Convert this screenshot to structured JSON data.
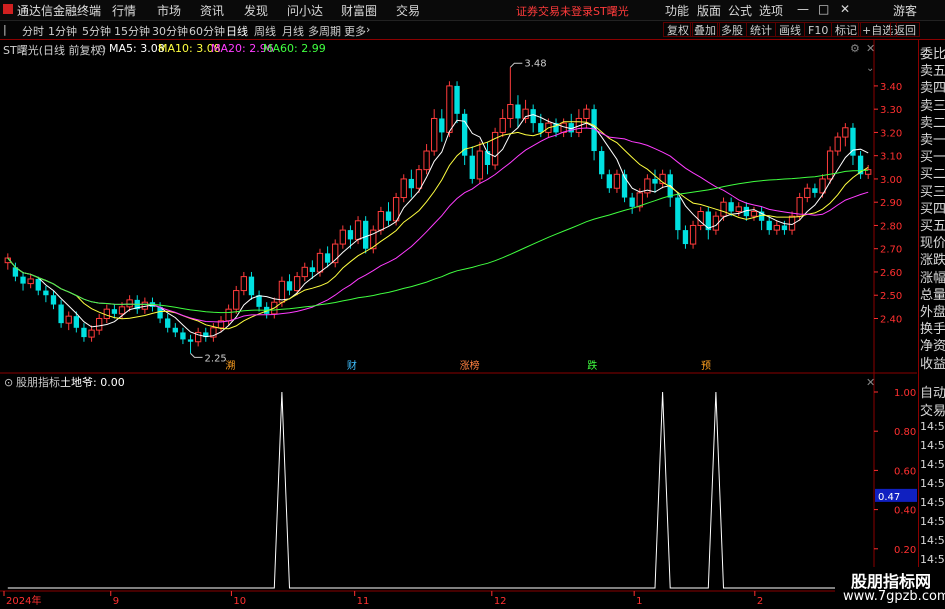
{
  "menubar": {
    "app_title": "通达信金融终端",
    "menus": [
      "行情",
      "市场",
      "资讯",
      "发现",
      "问小达",
      "财富圈",
      "交易"
    ],
    "login_alert": "证券交易未登录",
    "stock_title": "ST曙光",
    "right_menus": [
      "功能",
      "版面",
      "公式",
      "选项"
    ],
    "guest": "游客"
  },
  "toolbar": {
    "periods": [
      "分时",
      "1分钟",
      "5分钟",
      "15分钟",
      "30分钟",
      "60分钟",
      "日线",
      "周线",
      "月线",
      "多周期",
      "更多"
    ],
    "active_period": "日线",
    "right_buttons": [
      "复权",
      "叠加",
      "多股",
      "统计",
      "画线",
      "F10",
      "标记",
      "+自选",
      "返回"
    ]
  },
  "info": {
    "stock_label": "ST曙光(日线 前复权)",
    "ma5": "MA5: 3.08",
    "ma10": "MA10: 3.08",
    "ma20": "MA20: 2.96",
    "ma60": "MA60: 2.99"
  },
  "indicator": {
    "name": "股朋指标",
    "value_label": "土地爷: 0.00"
  },
  "price_axis": [
    "3.40",
    "3.30",
    "3.20",
    "3.10",
    "3.00",
    "2.90",
    "2.80",
    "2.70",
    "2.60",
    "2.50",
    "2.40"
  ],
  "indicator_axis": [
    "1.00",
    "0.80",
    "0.60",
    "0.47",
    "0.40",
    "0.20"
  ],
  "current_indicator_value": "0.47",
  "high_label": "3.48",
  "low_label": "2.25",
  "event_markers": [
    "溯",
    "财",
    "涨榜",
    "跌",
    "预"
  ],
  "date_axis": [
    "2024年",
    "9",
    "10",
    "11",
    "12",
    "1",
    "2"
  ],
  "right_panel": {
    "labels": [
      "委比",
      "卖五",
      "卖四",
      "卖三",
      "卖二",
      "卖一",
      "买一",
      "买二",
      "买三",
      "买四",
      "买五",
      "现价",
      "涨跌",
      "涨幅",
      "总量",
      "外盘",
      "换手",
      "净资",
      "收益"
    ],
    "labels2": [
      "自动",
      "交易"
    ],
    "times": [
      "14:53",
      "14:54",
      "14:54",
      "14:54",
      "14:55",
      "14:55",
      "14:56",
      "14:56",
      "14:56"
    ]
  },
  "watermark": {
    "line1": "股朋指标网",
    "line2": "www.7gpzb.com"
  },
  "colors": {
    "up": "#ff3c3c",
    "down": "#00e0e0",
    "ma5": "#ffffff",
    "ma10": "#ffff40",
    "ma20": "#ff3cff",
    "ma60": "#40ff40",
    "axis": "#ff3030"
  },
  "chart_data": {
    "type": "candlestick",
    "title": "ST曙光(日线 前复权)",
    "ylim": [
      2.2,
      3.52
    ],
    "high": 3.48,
    "low": 2.25,
    "bars": [
      [
        2.64,
        2.66,
        2.61,
        2.68
      ],
      [
        2.62,
        2.58,
        2.56,
        2.64
      ],
      [
        2.58,
        2.55,
        2.52,
        2.6
      ],
      [
        2.55,
        2.57,
        2.53,
        2.59
      ],
      [
        2.57,
        2.52,
        2.5,
        2.58
      ],
      [
        2.52,
        2.5,
        2.47,
        2.54
      ],
      [
        2.5,
        2.46,
        2.44,
        2.52
      ],
      [
        2.46,
        2.38,
        2.36,
        2.48
      ],
      [
        2.38,
        2.41,
        2.35,
        2.43
      ],
      [
        2.41,
        2.36,
        2.34,
        2.43
      ],
      [
        2.36,
        2.32,
        2.3,
        2.38
      ],
      [
        2.32,
        2.35,
        2.3,
        2.37
      ],
      [
        2.35,
        2.4,
        2.33,
        2.42
      ],
      [
        2.4,
        2.44,
        2.38,
        2.46
      ],
      [
        2.44,
        2.42,
        2.4,
        2.46
      ],
      [
        2.42,
        2.45,
        2.4,
        2.47
      ],
      [
        2.45,
        2.48,
        2.43,
        2.5
      ],
      [
        2.48,
        2.44,
        2.42,
        2.5
      ],
      [
        2.44,
        2.47,
        2.42,
        2.49
      ],
      [
        2.47,
        2.45,
        2.43,
        2.49
      ],
      [
        2.45,
        2.4,
        2.38,
        2.47
      ],
      [
        2.4,
        2.36,
        2.34,
        2.42
      ],
      [
        2.36,
        2.34,
        2.32,
        2.38
      ],
      [
        2.34,
        2.31,
        2.29,
        2.36
      ],
      [
        2.31,
        2.3,
        2.25,
        2.33
      ],
      [
        2.3,
        2.34,
        2.28,
        2.36
      ],
      [
        2.34,
        2.32,
        2.3,
        2.36
      ],
      [
        2.32,
        2.36,
        2.3,
        2.38
      ],
      [
        2.36,
        2.39,
        2.34,
        2.41
      ],
      [
        2.39,
        2.44,
        2.37,
        2.46
      ],
      [
        2.44,
        2.52,
        2.42,
        2.54
      ],
      [
        2.52,
        2.58,
        2.5,
        2.6
      ],
      [
        2.58,
        2.5,
        2.48,
        2.6
      ],
      [
        2.5,
        2.45,
        2.43,
        2.52
      ],
      [
        2.45,
        2.42,
        2.4,
        2.47
      ],
      [
        2.42,
        2.47,
        2.4,
        2.49
      ],
      [
        2.47,
        2.56,
        2.45,
        2.58
      ],
      [
        2.56,
        2.52,
        2.5,
        2.59
      ],
      [
        2.52,
        2.58,
        2.5,
        2.6
      ],
      [
        2.58,
        2.62,
        2.56,
        2.64
      ],
      [
        2.62,
        2.6,
        2.57,
        2.65
      ],
      [
        2.6,
        2.68,
        2.58,
        2.7
      ],
      [
        2.68,
        2.64,
        2.62,
        2.71
      ],
      [
        2.64,
        2.72,
        2.62,
        2.74
      ],
      [
        2.72,
        2.78,
        2.7,
        2.8
      ],
      [
        2.78,
        2.74,
        2.7,
        2.8
      ],
      [
        2.74,
        2.82,
        2.72,
        2.84
      ],
      [
        2.82,
        2.7,
        2.68,
        2.84
      ],
      [
        2.7,
        2.78,
        2.68,
        2.8
      ],
      [
        2.78,
        2.86,
        2.76,
        2.88
      ],
      [
        2.86,
        2.82,
        2.8,
        2.9
      ],
      [
        2.82,
        2.92,
        2.8,
        2.94
      ],
      [
        2.92,
        3.0,
        2.9,
        3.02
      ],
      [
        3.0,
        2.96,
        2.92,
        3.04
      ],
      [
        2.96,
        3.04,
        2.94,
        3.06
      ],
      [
        3.04,
        3.12,
        3.02,
        3.15
      ],
      [
        3.12,
        3.26,
        3.1,
        3.3
      ],
      [
        3.26,
        3.2,
        3.16,
        3.3
      ],
      [
        3.2,
        3.4,
        3.18,
        3.42
      ],
      [
        3.4,
        3.28,
        3.24,
        3.42
      ],
      [
        3.28,
        3.1,
        3.06,
        3.3
      ],
      [
        3.1,
        3.0,
        2.98,
        3.14
      ],
      [
        3.0,
        3.12,
        2.98,
        3.16
      ],
      [
        3.12,
        3.06,
        3.02,
        3.16
      ],
      [
        3.06,
        3.2,
        3.04,
        3.22
      ],
      [
        3.2,
        3.26,
        3.18,
        3.3
      ],
      [
        3.26,
        3.32,
        3.22,
        3.48
      ],
      [
        3.32,
        3.26,
        3.22,
        3.36
      ],
      [
        3.26,
        3.3,
        3.24,
        3.34
      ],
      [
        3.3,
        3.24,
        3.2,
        3.32
      ],
      [
        3.24,
        3.2,
        3.18,
        3.28
      ],
      [
        3.2,
        3.24,
        3.18,
        3.26
      ],
      [
        3.24,
        3.2,
        3.18,
        3.26
      ],
      [
        3.2,
        3.24,
        3.18,
        3.26
      ],
      [
        3.24,
        3.2,
        3.18,
        3.28
      ],
      [
        3.2,
        3.26,
        3.18,
        3.3
      ],
      [
        3.26,
        3.3,
        3.22,
        3.32
      ],
      [
        3.3,
        3.12,
        3.08,
        3.32
      ],
      [
        3.12,
        3.02,
        3.0,
        3.14
      ],
      [
        3.02,
        2.96,
        2.94,
        3.04
      ],
      [
        2.96,
        3.02,
        2.94,
        3.04
      ],
      [
        3.02,
        2.92,
        2.9,
        3.04
      ],
      [
        2.92,
        2.88,
        2.85,
        2.94
      ],
      [
        2.88,
        2.94,
        2.86,
        2.96
      ],
      [
        2.94,
        3.0,
        2.92,
        3.02
      ],
      [
        3.0,
        2.98,
        2.94,
        3.04
      ],
      [
        2.98,
        3.02,
        2.96,
        3.04
      ],
      [
        3.02,
        2.92,
        2.88,
        3.04
      ],
      [
        2.92,
        2.78,
        2.74,
        2.94
      ],
      [
        2.78,
        2.72,
        2.7,
        2.8
      ],
      [
        2.72,
        2.8,
        2.7,
        2.82
      ],
      [
        2.8,
        2.86,
        2.78,
        2.88
      ],
      [
        2.86,
        2.78,
        2.74,
        2.88
      ],
      [
        2.78,
        2.84,
        2.76,
        2.86
      ],
      [
        2.84,
        2.9,
        2.82,
        2.92
      ],
      [
        2.9,
        2.86,
        2.84,
        2.92
      ],
      [
        2.86,
        2.88,
        2.84,
        2.9
      ],
      [
        2.88,
        2.84,
        2.82,
        2.9
      ],
      [
        2.84,
        2.86,
        2.82,
        2.88
      ],
      [
        2.86,
        2.82,
        2.78,
        2.88
      ],
      [
        2.82,
        2.78,
        2.76,
        2.84
      ],
      [
        2.78,
        2.8,
        2.76,
        2.82
      ],
      [
        2.8,
        2.78,
        2.76,
        2.82
      ],
      [
        2.78,
        2.84,
        2.76,
        2.86
      ],
      [
        2.84,
        2.92,
        2.82,
        2.94
      ],
      [
        2.92,
        2.96,
        2.9,
        2.98
      ],
      [
        2.96,
        2.94,
        2.92,
        2.98
      ],
      [
        2.94,
        3.0,
        2.92,
        3.02
      ],
      [
        3.0,
        3.12,
        2.98,
        3.14
      ],
      [
        3.12,
        3.18,
        3.1,
        3.2
      ],
      [
        3.18,
        3.22,
        3.14,
        3.24
      ],
      [
        3.22,
        3.1,
        3.06,
        3.24
      ],
      [
        3.1,
        3.02,
        3.0,
        3.12
      ],
      [
        3.02,
        3.04,
        3.0,
        3.06
      ]
    ],
    "indicator_spikes_at_bar": [
      36,
      86,
      93
    ]
  }
}
